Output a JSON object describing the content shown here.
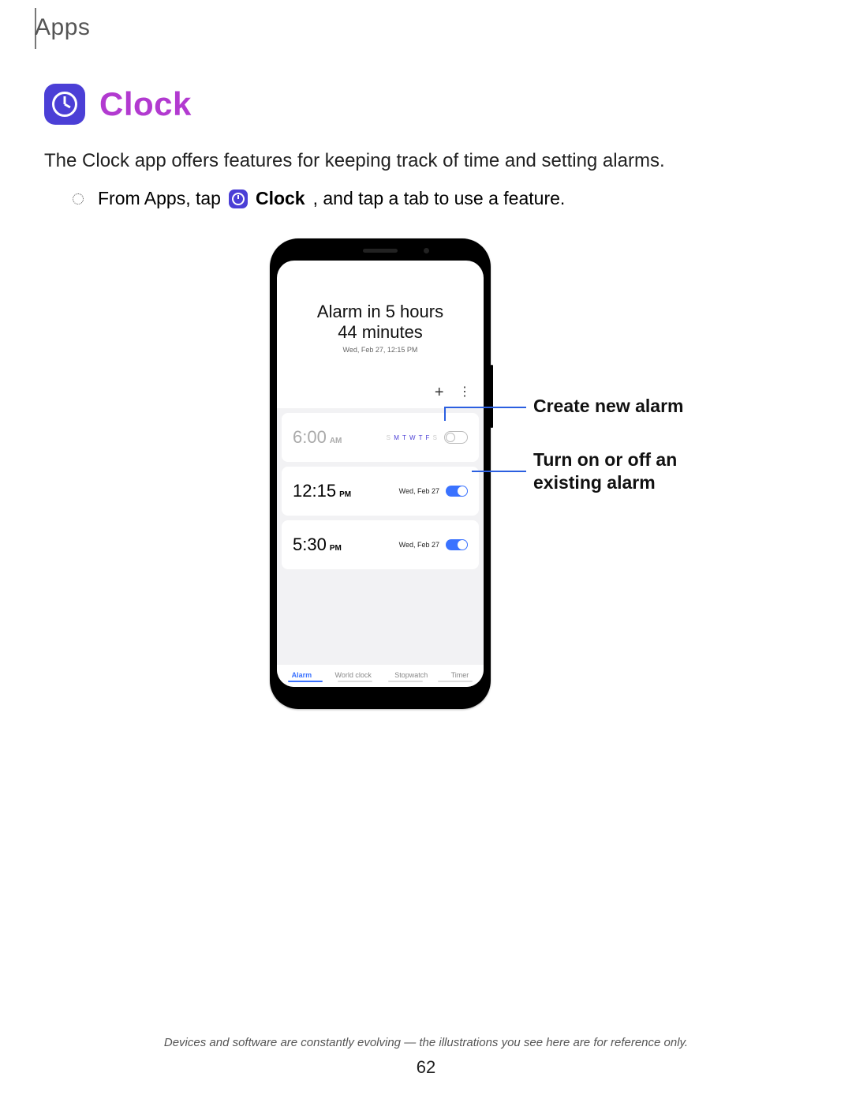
{
  "breadcrumb": "Apps",
  "title": "Clock",
  "intro": "The Clock app offers features for keeping track of time and setting alarms.",
  "step": {
    "pre": "From Apps, tap ",
    "bold": "Clock",
    "post": ", and tap a tab to use a feature."
  },
  "phone": {
    "header_line1": "Alarm in 5 hours",
    "header_line2": "44 minutes",
    "header_sub": "Wed, Feb 27, 12:15 PM",
    "toolbar": {
      "plus": "+",
      "more": "⋮"
    },
    "alarms": [
      {
        "time": "6:00",
        "suffix": "AM",
        "days": "S M T W T F S",
        "enabled": false
      },
      {
        "time": "12:15",
        "suffix": "PM",
        "date": "Wed, Feb 27",
        "enabled": true
      },
      {
        "time": "5:30",
        "suffix": "PM",
        "date": "Wed, Feb 27",
        "enabled": true
      }
    ],
    "tabs": [
      "Alarm",
      "World clock",
      "Stopwatch",
      "Timer"
    ],
    "active_tab": "Alarm"
  },
  "callouts": {
    "create": "Create new alarm",
    "toggle_l1": "Turn on or off an",
    "toggle_l2": "existing alarm"
  },
  "footer": "Devices and software are constantly evolving — the illustrations you see here are for reference only.",
  "page_number": "62"
}
